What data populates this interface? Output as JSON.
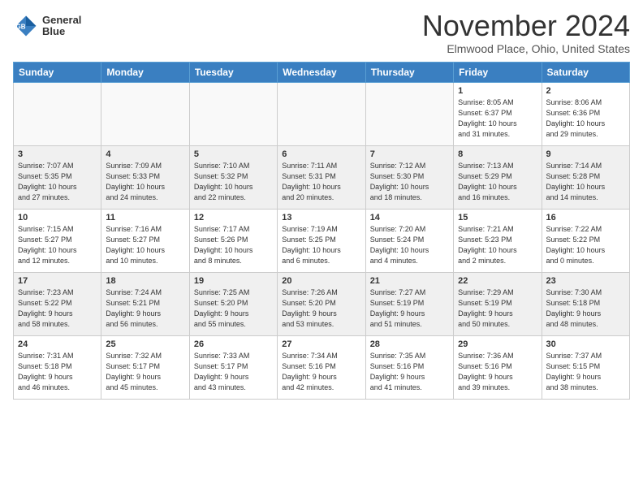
{
  "header": {
    "logo_line1": "General",
    "logo_line2": "Blue",
    "month": "November 2024",
    "location": "Elmwood Place, Ohio, United States"
  },
  "weekdays": [
    "Sunday",
    "Monday",
    "Tuesday",
    "Wednesday",
    "Thursday",
    "Friday",
    "Saturday"
  ],
  "weeks": [
    [
      {
        "day": "",
        "info": ""
      },
      {
        "day": "",
        "info": ""
      },
      {
        "day": "",
        "info": ""
      },
      {
        "day": "",
        "info": ""
      },
      {
        "day": "",
        "info": ""
      },
      {
        "day": "1",
        "info": "Sunrise: 8:05 AM\nSunset: 6:37 PM\nDaylight: 10 hours\nand 31 minutes."
      },
      {
        "day": "2",
        "info": "Sunrise: 8:06 AM\nSunset: 6:36 PM\nDaylight: 10 hours\nand 29 minutes."
      }
    ],
    [
      {
        "day": "3",
        "info": "Sunrise: 7:07 AM\nSunset: 5:35 PM\nDaylight: 10 hours\nand 27 minutes."
      },
      {
        "day": "4",
        "info": "Sunrise: 7:09 AM\nSunset: 5:33 PM\nDaylight: 10 hours\nand 24 minutes."
      },
      {
        "day": "5",
        "info": "Sunrise: 7:10 AM\nSunset: 5:32 PM\nDaylight: 10 hours\nand 22 minutes."
      },
      {
        "day": "6",
        "info": "Sunrise: 7:11 AM\nSunset: 5:31 PM\nDaylight: 10 hours\nand 20 minutes."
      },
      {
        "day": "7",
        "info": "Sunrise: 7:12 AM\nSunset: 5:30 PM\nDaylight: 10 hours\nand 18 minutes."
      },
      {
        "day": "8",
        "info": "Sunrise: 7:13 AM\nSunset: 5:29 PM\nDaylight: 10 hours\nand 16 minutes."
      },
      {
        "day": "9",
        "info": "Sunrise: 7:14 AM\nSunset: 5:28 PM\nDaylight: 10 hours\nand 14 minutes."
      }
    ],
    [
      {
        "day": "10",
        "info": "Sunrise: 7:15 AM\nSunset: 5:27 PM\nDaylight: 10 hours\nand 12 minutes."
      },
      {
        "day": "11",
        "info": "Sunrise: 7:16 AM\nSunset: 5:27 PM\nDaylight: 10 hours\nand 10 minutes."
      },
      {
        "day": "12",
        "info": "Sunrise: 7:17 AM\nSunset: 5:26 PM\nDaylight: 10 hours\nand 8 minutes."
      },
      {
        "day": "13",
        "info": "Sunrise: 7:19 AM\nSunset: 5:25 PM\nDaylight: 10 hours\nand 6 minutes."
      },
      {
        "day": "14",
        "info": "Sunrise: 7:20 AM\nSunset: 5:24 PM\nDaylight: 10 hours\nand 4 minutes."
      },
      {
        "day": "15",
        "info": "Sunrise: 7:21 AM\nSunset: 5:23 PM\nDaylight: 10 hours\nand 2 minutes."
      },
      {
        "day": "16",
        "info": "Sunrise: 7:22 AM\nSunset: 5:22 PM\nDaylight: 10 hours\nand 0 minutes."
      }
    ],
    [
      {
        "day": "17",
        "info": "Sunrise: 7:23 AM\nSunset: 5:22 PM\nDaylight: 9 hours\nand 58 minutes."
      },
      {
        "day": "18",
        "info": "Sunrise: 7:24 AM\nSunset: 5:21 PM\nDaylight: 9 hours\nand 56 minutes."
      },
      {
        "day": "19",
        "info": "Sunrise: 7:25 AM\nSunset: 5:20 PM\nDaylight: 9 hours\nand 55 minutes."
      },
      {
        "day": "20",
        "info": "Sunrise: 7:26 AM\nSunset: 5:20 PM\nDaylight: 9 hours\nand 53 minutes."
      },
      {
        "day": "21",
        "info": "Sunrise: 7:27 AM\nSunset: 5:19 PM\nDaylight: 9 hours\nand 51 minutes."
      },
      {
        "day": "22",
        "info": "Sunrise: 7:29 AM\nSunset: 5:19 PM\nDaylight: 9 hours\nand 50 minutes."
      },
      {
        "day": "23",
        "info": "Sunrise: 7:30 AM\nSunset: 5:18 PM\nDaylight: 9 hours\nand 48 minutes."
      }
    ],
    [
      {
        "day": "24",
        "info": "Sunrise: 7:31 AM\nSunset: 5:18 PM\nDaylight: 9 hours\nand 46 minutes."
      },
      {
        "day": "25",
        "info": "Sunrise: 7:32 AM\nSunset: 5:17 PM\nDaylight: 9 hours\nand 45 minutes."
      },
      {
        "day": "26",
        "info": "Sunrise: 7:33 AM\nSunset: 5:17 PM\nDaylight: 9 hours\nand 43 minutes."
      },
      {
        "day": "27",
        "info": "Sunrise: 7:34 AM\nSunset: 5:16 PM\nDaylight: 9 hours\nand 42 minutes."
      },
      {
        "day": "28",
        "info": "Sunrise: 7:35 AM\nSunset: 5:16 PM\nDaylight: 9 hours\nand 41 minutes."
      },
      {
        "day": "29",
        "info": "Sunrise: 7:36 AM\nSunset: 5:16 PM\nDaylight: 9 hours\nand 39 minutes."
      },
      {
        "day": "30",
        "info": "Sunrise: 7:37 AM\nSunset: 5:15 PM\nDaylight: 9 hours\nand 38 minutes."
      }
    ]
  ],
  "colors": {
    "header_bg": "#3a7fc1",
    "header_text": "#ffffff",
    "empty_bg": "#f9f9f9",
    "shaded_bg": "#f0f0f0"
  }
}
